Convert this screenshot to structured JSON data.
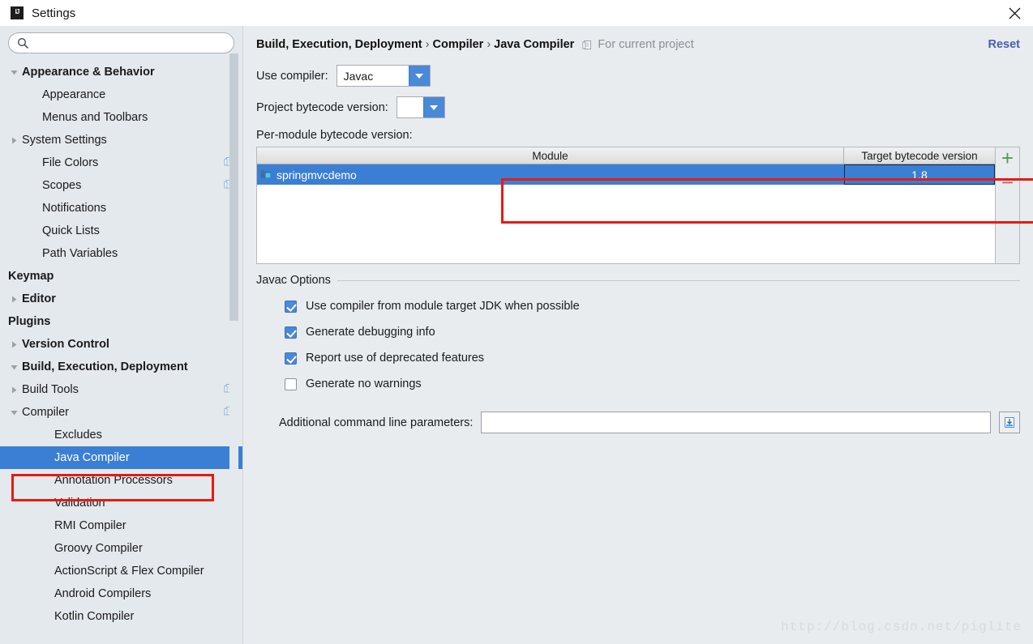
{
  "window": {
    "title": "Settings",
    "app_icon": "intellij-idea-icon",
    "close_label": "close-icon"
  },
  "sidebar": {
    "search": {
      "value": "",
      "placeholder": ""
    },
    "items": [
      {
        "label": "Appearance & Behavior",
        "level": 0,
        "bold": true,
        "twisty": "down",
        "copy": false,
        "selected": false
      },
      {
        "label": "Appearance",
        "level": 1,
        "bold": false,
        "twisty": "none",
        "copy": false,
        "selected": false
      },
      {
        "label": "Menus and Toolbars",
        "level": 1,
        "bold": false,
        "twisty": "none",
        "copy": false,
        "selected": false
      },
      {
        "label": "System Settings",
        "level": 1,
        "bold": false,
        "twisty": "right",
        "copy": false,
        "selected": false
      },
      {
        "label": "File Colors",
        "level": 1,
        "bold": false,
        "twisty": "none",
        "copy": true,
        "selected": false
      },
      {
        "label": "Scopes",
        "level": 1,
        "bold": false,
        "twisty": "none",
        "copy": true,
        "selected": false
      },
      {
        "label": "Notifications",
        "level": 1,
        "bold": false,
        "twisty": "none",
        "copy": false,
        "selected": false
      },
      {
        "label": "Quick Lists",
        "level": 1,
        "bold": false,
        "twisty": "none",
        "copy": false,
        "selected": false
      },
      {
        "label": "Path Variables",
        "level": 1,
        "bold": false,
        "twisty": "none",
        "copy": false,
        "selected": false
      },
      {
        "label": "Keymap",
        "level": 0,
        "bold": true,
        "twisty": "none",
        "copy": false,
        "selected": false
      },
      {
        "label": "Editor",
        "level": 0,
        "bold": true,
        "twisty": "right",
        "copy": false,
        "selected": false
      },
      {
        "label": "Plugins",
        "level": 0,
        "bold": true,
        "twisty": "none",
        "copy": false,
        "selected": false
      },
      {
        "label": "Version Control",
        "level": 0,
        "bold": true,
        "twisty": "right",
        "copy": false,
        "selected": false
      },
      {
        "label": "Build, Execution, Deployment",
        "level": 0,
        "bold": true,
        "twisty": "down",
        "copy": false,
        "selected": false
      },
      {
        "label": "Build Tools",
        "level": 1,
        "bold": false,
        "twisty": "right",
        "copy": true,
        "selected": false
      },
      {
        "label": "Compiler",
        "level": 1,
        "bold": false,
        "twisty": "down",
        "copy": true,
        "selected": false
      },
      {
        "label": "Excludes",
        "level": 2,
        "bold": false,
        "twisty": "none",
        "copy": false,
        "selected": false
      },
      {
        "label": "Java Compiler",
        "level": 2,
        "bold": false,
        "twisty": "none",
        "copy": false,
        "selected": true
      },
      {
        "label": "Annotation Processors",
        "level": 2,
        "bold": false,
        "twisty": "none",
        "copy": false,
        "selected": false
      },
      {
        "label": "Validation",
        "level": 2,
        "bold": false,
        "twisty": "none",
        "copy": false,
        "selected": false
      },
      {
        "label": "RMI Compiler",
        "level": 2,
        "bold": false,
        "twisty": "none",
        "copy": false,
        "selected": false
      },
      {
        "label": "Groovy Compiler",
        "level": 2,
        "bold": false,
        "twisty": "none",
        "copy": false,
        "selected": false
      },
      {
        "label": "ActionScript & Flex Compiler",
        "level": 2,
        "bold": false,
        "twisty": "none",
        "copy": false,
        "selected": false
      },
      {
        "label": "Android Compilers",
        "level": 2,
        "bold": false,
        "twisty": "none",
        "copy": false,
        "selected": false
      },
      {
        "label": "Kotlin Compiler",
        "level": 2,
        "bold": false,
        "twisty": "none",
        "copy": false,
        "selected": false
      }
    ]
  },
  "content": {
    "breadcrumb": {
      "part1": "Build, Execution, Deployment",
      "sep1": "›",
      "part2": "Compiler",
      "sep2": "›",
      "part3": "Java Compiler"
    },
    "scope_note": "For current project",
    "reset_label": "Reset",
    "use_compiler": {
      "label": "Use compiler:",
      "value": "Javac"
    },
    "project_bytecode": {
      "label": "Project bytecode version:",
      "value": ""
    },
    "per_module_label": "Per-module bytecode version:",
    "table": {
      "columns": [
        "Module",
        "Target bytecode version"
      ],
      "rows": [
        {
          "module": "springmvcdemo",
          "target": "1.8",
          "selected": true
        }
      ],
      "add_label": "+",
      "remove_label": "−"
    },
    "javac_options": {
      "legend": "Javac Options",
      "checkboxes": [
        {
          "label": "Use compiler from module target JDK when possible",
          "checked": true
        },
        {
          "label": "Generate debugging info",
          "checked": true
        },
        {
          "label": "Report use of deprecated features",
          "checked": true
        },
        {
          "label": "Generate no warnings",
          "checked": false
        }
      ],
      "params": {
        "label": "Additional command line parameters:",
        "value": "",
        "placeholder": "",
        "expand_icon": "expand-editor-icon"
      }
    }
  },
  "watermark": "http://blog.csdn.net/piglite",
  "colors": {
    "selection_blue": "#3b7fd4",
    "accent_blue": "#4a88d8",
    "highlight_red": "#e81a12",
    "link": "#4a5ea8",
    "panel_bg": "#e9ecef",
    "sidebar_bg": "#e4e9ed",
    "add_green": "#4fa04f",
    "remove_red": "#c0665f"
  }
}
